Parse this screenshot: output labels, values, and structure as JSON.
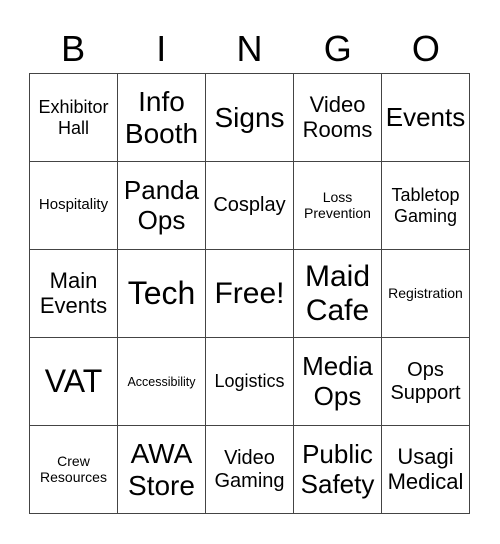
{
  "header": [
    "B",
    "I",
    "N",
    "G",
    "O"
  ],
  "cells": [
    [
      "Exhibitor Hall",
      "Info Booth",
      "Signs",
      "Video Rooms",
      "Events"
    ],
    [
      "Hospitality",
      "Panda Ops",
      "Cosplay",
      "Loss Prevention",
      "Tabletop Gaming"
    ],
    [
      "Main Events",
      "Tech",
      "Free!",
      "Maid Cafe",
      "Registration"
    ],
    [
      "VAT",
      "Accessibility",
      "Logistics",
      "Media Ops",
      "Ops Support"
    ],
    [
      "Crew Resources",
      "AWA Store",
      "Video Gaming",
      "Public Safety",
      "Usagi Medical"
    ]
  ]
}
